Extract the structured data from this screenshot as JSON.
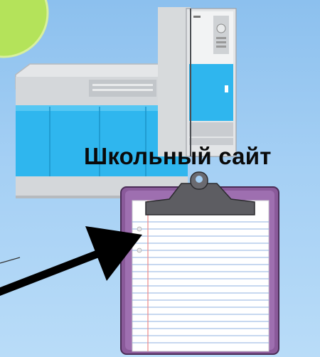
{
  "caption": "Школьный сайт",
  "colors": {
    "background": "#a4cff4",
    "circle": "#b4e35a",
    "machine_blue": "#2fb6ee",
    "machine_gray": "#d6d8da",
    "clipboard_frame": "#8a5a9a",
    "paper": "#ffffff",
    "paper_lines": "#8fb0e0",
    "arrow": "#000000"
  },
  "icons": {
    "circle": "green-circle-decoration",
    "machine": "computer-machine-icon",
    "clipboard": "clipboard-icon",
    "arrow": "arrow-icon"
  }
}
